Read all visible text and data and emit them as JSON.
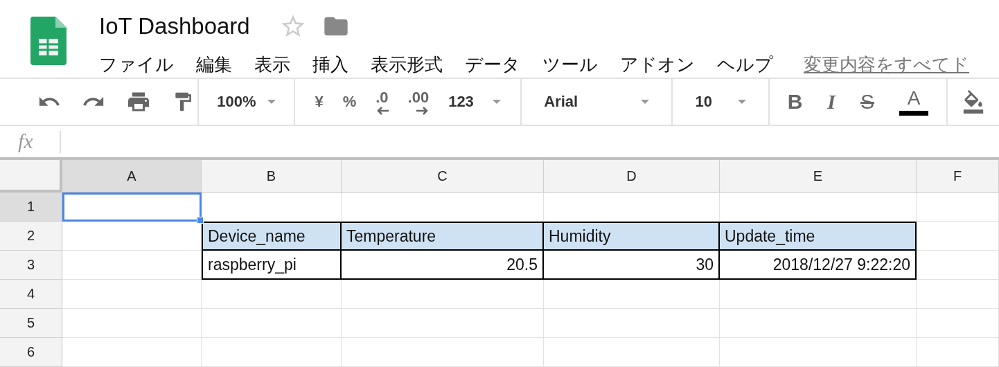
{
  "document": {
    "title": "IoT Dashboard",
    "starred": false
  },
  "menu": [
    "ファイル",
    "編集",
    "表示",
    "挿入",
    "表示形式",
    "データ",
    "ツール",
    "アドオン",
    "ヘルプ"
  ],
  "save_status": "変更内容をすべてド",
  "toolbar": {
    "zoom": "100%",
    "currency": "¥",
    "percent": "%",
    "decrease_decimal": ".0",
    "increase_decimal": ".00",
    "more_formats": "123",
    "font": "Arial",
    "font_size": "10",
    "bold": "B",
    "italic": "I",
    "strikethrough": "S",
    "text_color_label": "A"
  },
  "formula_bar": {
    "label": "fx"
  },
  "grid": {
    "columns": [
      {
        "label": "A",
        "selected": true
      },
      {
        "label": "B",
        "selected": false
      },
      {
        "label": "C",
        "selected": false
      },
      {
        "label": "D",
        "selected": false
      },
      {
        "label": "E",
        "selected": false
      },
      {
        "label": "F",
        "selected": false
      }
    ],
    "rows": [
      {
        "label": "1",
        "selected": true,
        "cells": [
          {
            "kind": "text",
            "text": "",
            "selected": true
          },
          {
            "kind": "text",
            "text": "",
            "selected": false
          },
          {
            "kind": "text",
            "text": "",
            "selected": false
          },
          {
            "kind": "text",
            "text": "",
            "selected": false
          },
          {
            "kind": "text",
            "text": "",
            "selected": false
          },
          {
            "kind": "text",
            "text": "",
            "selected": false
          }
        ]
      },
      {
        "label": "2",
        "selected": false,
        "cells": [
          {
            "kind": "text",
            "text": "",
            "selected": false
          },
          {
            "kind": "header",
            "text": "Device_name",
            "selected": false
          },
          {
            "kind": "header",
            "text": "Temperature",
            "selected": false
          },
          {
            "kind": "header",
            "text": "Humidity",
            "selected": false
          },
          {
            "kind": "header",
            "text": "Update_time",
            "selected": false
          },
          {
            "kind": "text",
            "text": "",
            "selected": false
          }
        ]
      },
      {
        "label": "3",
        "selected": false,
        "cells": [
          {
            "kind": "text",
            "text": "",
            "selected": false
          },
          {
            "kind": "boxed",
            "text": "raspberry_pi",
            "selected": false
          },
          {
            "kind": "boxed_number",
            "text": "20.5",
            "selected": false
          },
          {
            "kind": "boxed_number",
            "text": "30",
            "selected": false
          },
          {
            "kind": "boxed_number",
            "text": "2018/12/27 9:22:20",
            "selected": false
          },
          {
            "kind": "text",
            "text": "",
            "selected": false
          }
        ]
      },
      {
        "label": "4",
        "selected": false,
        "cells": [
          {
            "kind": "text",
            "text": "",
            "selected": false
          },
          {
            "kind": "text",
            "text": "",
            "selected": false
          },
          {
            "kind": "text",
            "text": "",
            "selected": false
          },
          {
            "kind": "text",
            "text": "",
            "selected": false
          },
          {
            "kind": "text",
            "text": "",
            "selected": false
          },
          {
            "kind": "text",
            "text": "",
            "selected": false
          }
        ]
      },
      {
        "label": "5",
        "selected": false,
        "cells": [
          {
            "kind": "text",
            "text": "",
            "selected": false
          },
          {
            "kind": "text",
            "text": "",
            "selected": false
          },
          {
            "kind": "text",
            "text": "",
            "selected": false
          },
          {
            "kind": "text",
            "text": "",
            "selected": false
          },
          {
            "kind": "text",
            "text": "",
            "selected": false
          },
          {
            "kind": "text",
            "text": "",
            "selected": false
          }
        ]
      },
      {
        "label": "6",
        "selected": false,
        "cells": [
          {
            "kind": "text",
            "text": "",
            "selected": false
          },
          {
            "kind": "text",
            "text": "",
            "selected": false
          },
          {
            "kind": "text",
            "text": "",
            "selected": false
          },
          {
            "kind": "text",
            "text": "",
            "selected": false
          },
          {
            "kind": "text",
            "text": "",
            "selected": false
          },
          {
            "kind": "text",
            "text": "",
            "selected": false
          }
        ]
      }
    ]
  }
}
